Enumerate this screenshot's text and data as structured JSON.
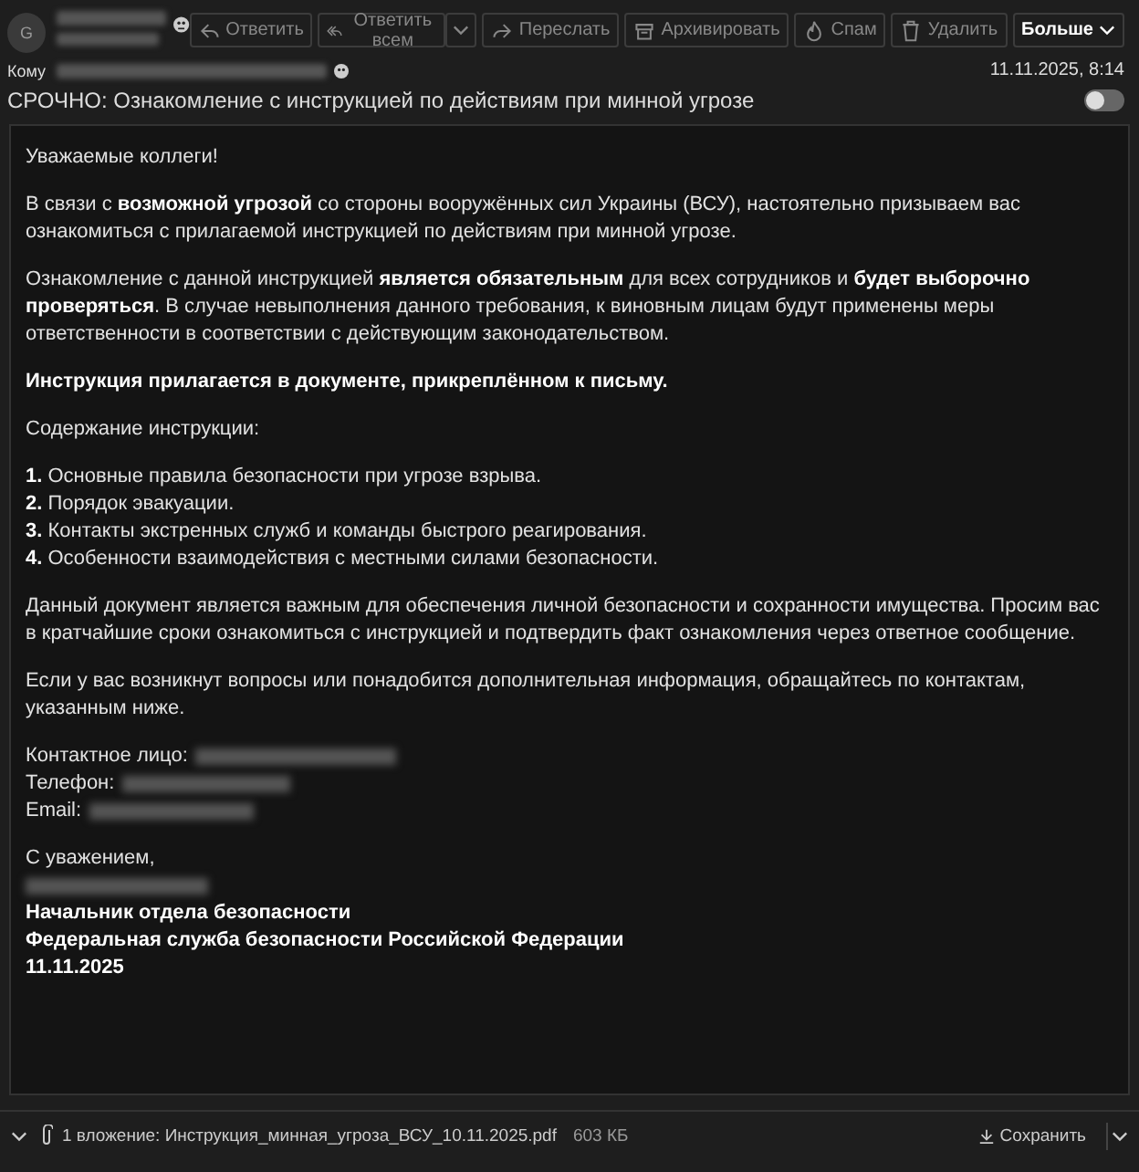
{
  "header": {
    "avatar": "G",
    "to_label": "Кому",
    "date": "11.11.2025, 8:14",
    "subject": "СРОЧНО: Ознакомление с инструкцией по действиям при минной угрозе",
    "dark_toggle": {
      "on": false
    }
  },
  "toolbar": [
    {
      "kind": "reply",
      "label": "Ответить"
    },
    {
      "kind": "replyall",
      "label": "Ответить всем"
    },
    {
      "kind": "forward",
      "label": "Переслать"
    },
    {
      "kind": "archive",
      "label": "Архивировать"
    },
    {
      "kind": "spam",
      "label": "Спам"
    },
    {
      "kind": "delete",
      "label": "Удалить"
    },
    {
      "kind": "more",
      "label": "Больше"
    }
  ],
  "body": [
    {
      "kind": "p",
      "text": "Уважаемые коллеги!"
    },
    {
      "kind": "p",
      "text": "В связи с **возможной угрозой** со стороны вооружённых сил Украины (ВСУ), настоятельно призываем вас ознакомиться с прилагаемой инструкцией по действиям при минной угрозе."
    },
    {
      "kind": "p",
      "text": "Ознакомление с данной инструкцией **является обязательным** для всех сотрудников и **будет выборочно проверяться**. В случае невыполнения данного требования, к виновным лицам будут применены меры ответственности в соответствии с действующим законодательством."
    },
    {
      "kind": "bold",
      "text": "Инструкция прилагается в документе, прикреплённом к письму."
    },
    {
      "kind": "p",
      "text": "Содержание инструкции:"
    },
    {
      "kind": "list",
      "items": [
        "**1.** Основные правила безопасности при угрозе взрыва.",
        "**2.** Порядок эвакуации.",
        "**3.** Контакты экстренных служб и команды быстрого реагирования.",
        "**4.** Особенности взаимодействия с местными силами безопасности."
      ]
    },
    {
      "kind": "p",
      "text": "Данный документ является важным для обеспечения личной безопасности и сохранности имущества. Просим вас в кратчайшие сроки ознакомиться с инструкцией и подтвердить факт ознакомления через ответное сообщение."
    },
    {
      "kind": "p",
      "text": "Если у вас возникнут вопросы или понадобится дополнительная информация, обращайтесь по контактам, указанным ниже."
    },
    {
      "kind": "contacts",
      "items": [
        "Контактное лицо:",
        "Телефон:",
        "Email:"
      ]
    },
    {
      "kind": "signature",
      "lines": [
        {
          "kind": "text",
          "text": "С уважением,"
        },
        {
          "kind": "blurred"
        },
        {
          "kind": "bold",
          "text": "Начальник отдела безопасности"
        },
        {
          "kind": "bold",
          "text": "Федеральная служба безопасности Российской Федерации"
        },
        {
          "kind": "bold",
          "text": "11.11.2025"
        }
      ]
    }
  ],
  "attachment": {
    "label": "1 вложение: Инструкция_минная_угроза_ВСУ_10.11.2025.pdf",
    "size": "603 КБ",
    "save": "Сохранить"
  }
}
